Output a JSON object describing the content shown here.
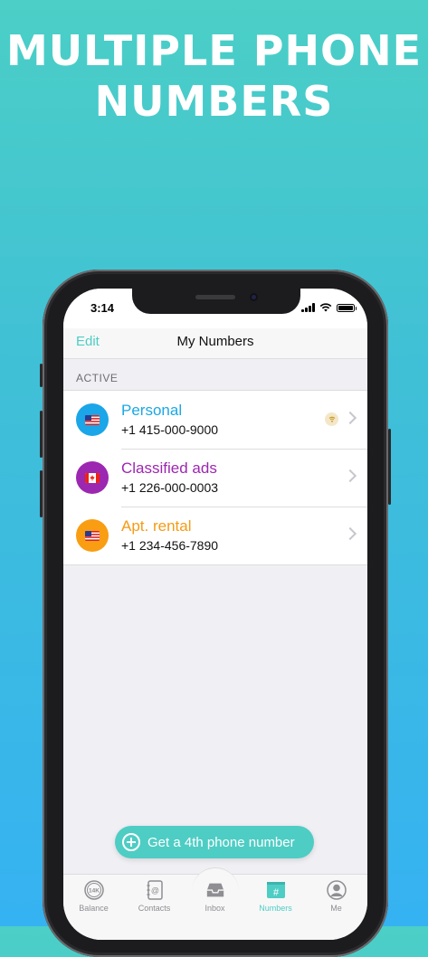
{
  "headline": {
    "line1": "MULTIPLE PHONE",
    "line2": "NUMBERS"
  },
  "status_bar": {
    "time": "3:14"
  },
  "nav": {
    "edit_label": "Edit",
    "title": "My Numbers"
  },
  "section": {
    "header": "ACTIVE"
  },
  "numbers": [
    {
      "name": "Personal",
      "number": "+1 415-000-9000",
      "name_color": "#1ba8e3",
      "circle_color": "#1aa6e8",
      "flag": "us-flag-icon",
      "badge": "wifi-badge-icon"
    },
    {
      "name": "Classified ads",
      "number": "+1 226-000-0003",
      "name_color": "#9c27b0",
      "circle_color": "#9c27b0",
      "flag": "canada-flag-icon"
    },
    {
      "name": "Apt. rental",
      "number": "+1 234-456-7890",
      "name_color": "#f59b16",
      "circle_color": "#f99d12",
      "flag": "us-flag-icon"
    }
  ],
  "cta": {
    "label": "Get a 4th phone number"
  },
  "tabs": [
    {
      "label": "Balance",
      "icon": "balance-14k-icon",
      "badge_text": "14K"
    },
    {
      "label": "Contacts",
      "icon": "contacts-icon"
    },
    {
      "label": "Inbox",
      "icon": "inbox-icon"
    },
    {
      "label": "Numbers",
      "icon": "numbers-hash-icon",
      "active": true
    },
    {
      "label": "Me",
      "icon": "profile-icon"
    }
  ],
  "colors": {
    "accent": "#4ecdc4",
    "background_top": "#4bcfc6",
    "background_bottom": "#35b2f2"
  }
}
